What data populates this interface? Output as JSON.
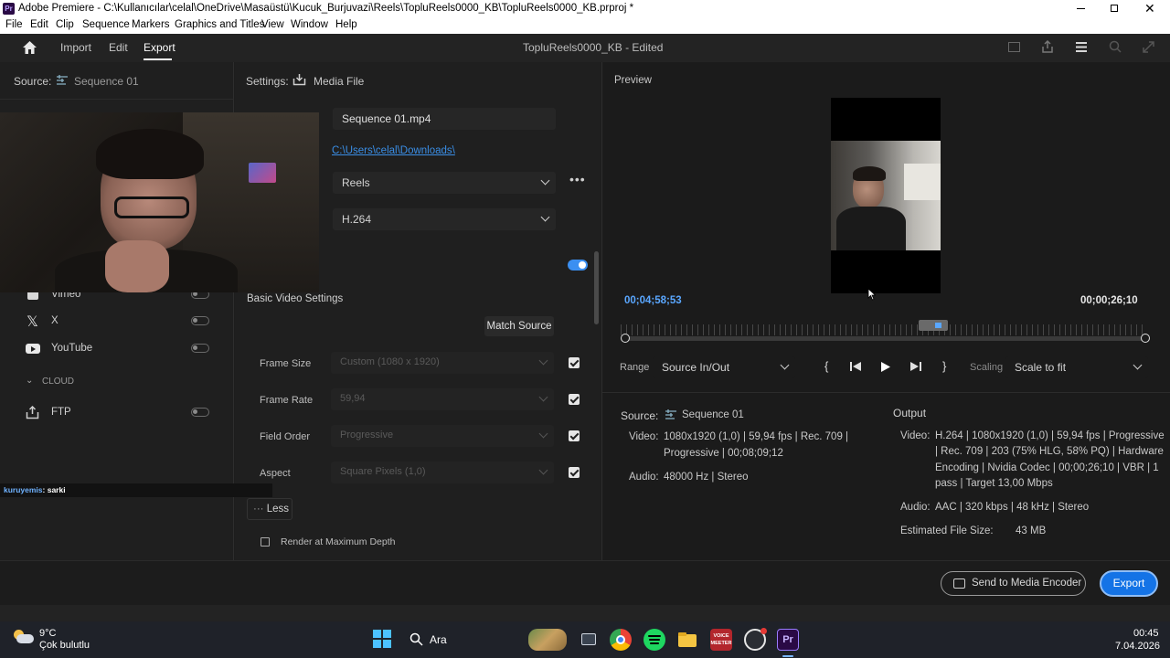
{
  "window": {
    "title": "Adobe Premiere - C:\\Kullanıcılar\\celal\\OneDrive\\Masaüstü\\Kucuk_Burjuvazi\\Reels\\TopluReels0000_KB\\TopluReels0000_KB.prproj *",
    "app_badge": "Pr"
  },
  "menu": [
    "File",
    "Edit",
    "Clip",
    "Sequence",
    "Markers",
    "Graphics and Titles",
    "View",
    "Window",
    "Help"
  ],
  "header": {
    "tabs": [
      "Import",
      "Edit",
      "Export"
    ],
    "active_tab": "Export",
    "project_title": "TopluReels0000_KB - Edited"
  },
  "left": {
    "source_label": "Source:",
    "source_value": "Sequence 01",
    "destinations": [
      {
        "label": "Vimeo",
        "checked": true
      },
      {
        "label": "X",
        "checked": false
      },
      {
        "label": "YouTube",
        "checked": false
      }
    ],
    "cloud_label": "CLOUD",
    "ftp_label": "FTP",
    "chat_user": "kuruyemis",
    "chat_text": ": sarki"
  },
  "settings": {
    "label": "Settings:",
    "media_file": "Media File",
    "file_name": "Sequence 01.mp4",
    "location": "C:\\Users\\celal\\Downloads\\",
    "preset": "Reels",
    "format": "H.264",
    "section_title": "Basic Video Settings",
    "match_source": "Match Source",
    "rows": [
      {
        "label": "Frame Size",
        "value": "Custom (1080 x 1920)"
      },
      {
        "label": "Frame Rate",
        "value": "59,94"
      },
      {
        "label": "Field Order",
        "value": "Progressive"
      },
      {
        "label": "Aspect",
        "value": "Square Pixels (1,0)"
      }
    ],
    "less": "Less",
    "render_max_depth": "Render at Maximum Depth"
  },
  "preview": {
    "label": "Preview",
    "time_current": "00;04;58;53",
    "time_duration": "00;00;26;10",
    "range_label": "Range",
    "range_value": "Source In/Out",
    "scaling_label": "Scaling",
    "scaling_value": "Scale to fit"
  },
  "source_info": {
    "title": "Source:",
    "sequence": "Sequence 01",
    "video_label": "Video:",
    "video_line1": "1080x1920 (1,0) | 59,94 fps | Rec. 709 |",
    "video_line2": "Progressive | 00;08;09;12",
    "audio_label": "Audio:",
    "audio": "48000 Hz | Stereo"
  },
  "output_info": {
    "title": "Output",
    "video_label": "Video:",
    "video_lines": [
      "H.264 | 1080x1920 (1,0) | 59,94 fps | Progressive",
      "| Rec. 709 | 203 (75% HLG, 58% PQ) | Hardware",
      "Encoding | Nvidia Codec | 00;00;26;10 | VBR | 1",
      "pass | Target 13,00 Mbps"
    ],
    "audio_label": "Audio:",
    "audio": "AAC | 320 kbps | 48 kHz | Stereo",
    "size_label": "Estimated File Size:",
    "size": "43 MB"
  },
  "footer": {
    "send_to_encoder": "Send to Media Encoder",
    "export": "Export"
  },
  "taskbar": {
    "temp": "9°C",
    "weather": "Çok bulutlu",
    "search": "Ara",
    "time": "00:45",
    "date": "7.04.2026"
  },
  "colors": {
    "accent": "#1473e6",
    "link": "#3a8ee6",
    "time_blue": "#5aa7ff"
  }
}
